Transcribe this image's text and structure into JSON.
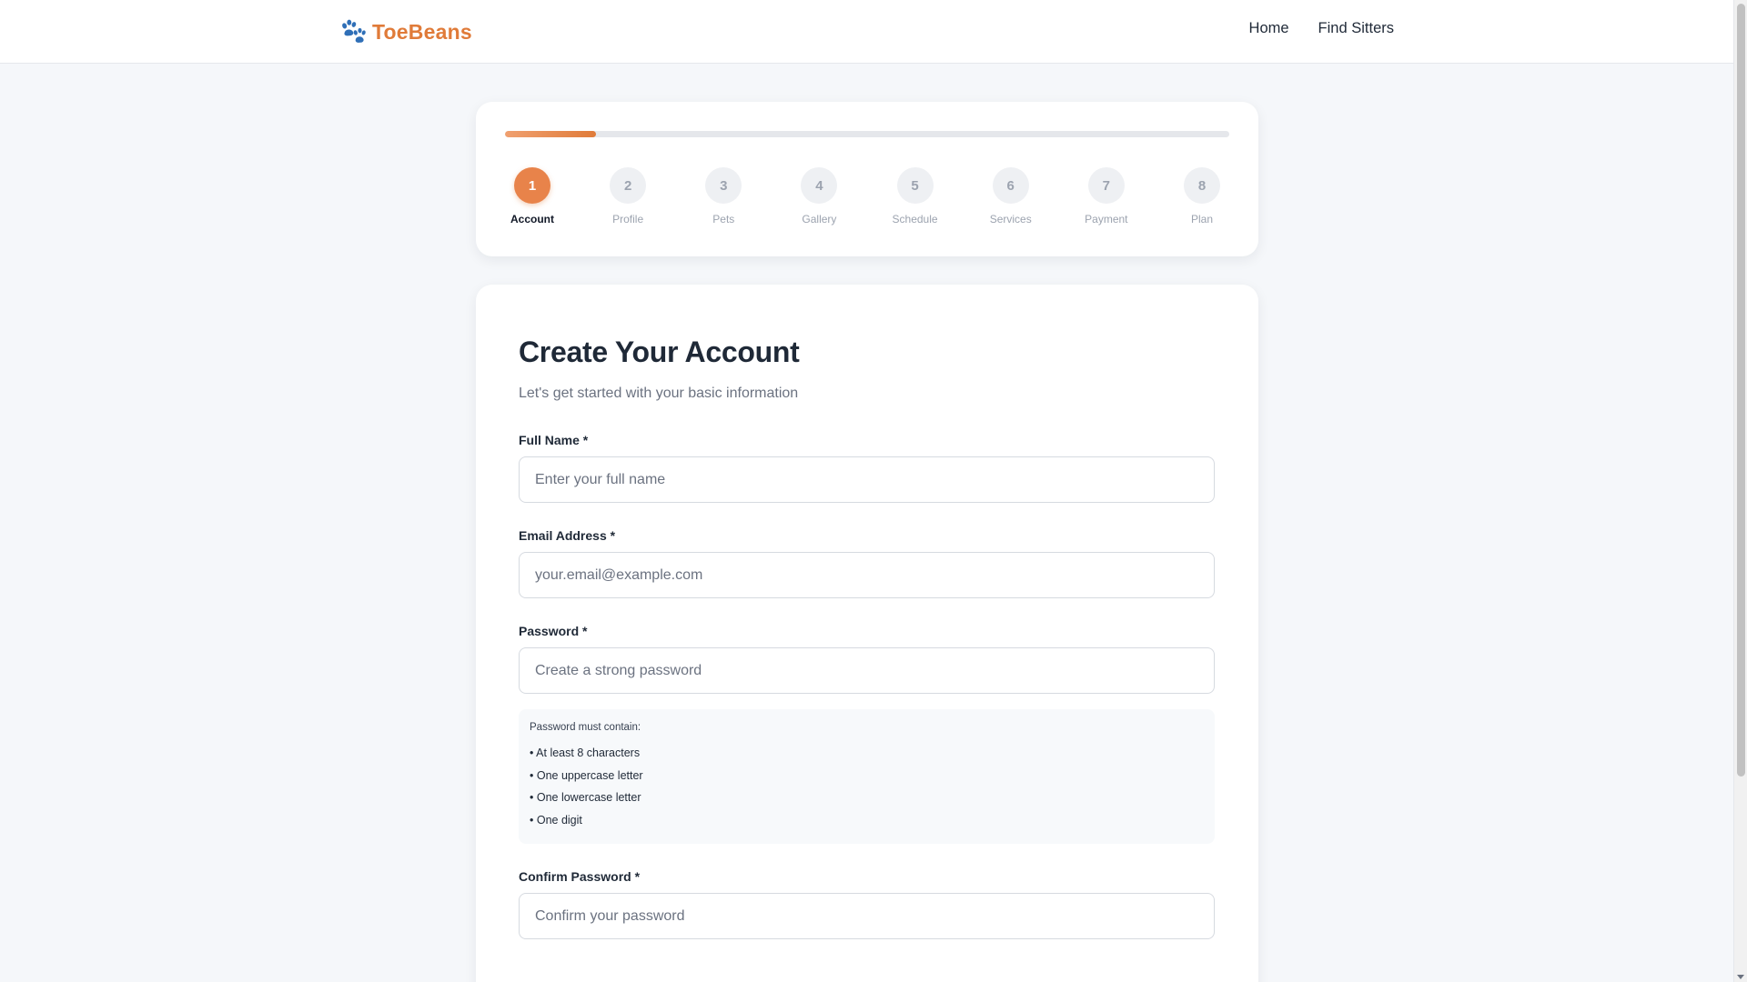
{
  "header": {
    "brand": "ToeBeans",
    "logo_icon": "paw-icon",
    "brand_color": "#e07b39",
    "nav": [
      {
        "label": "Home"
      },
      {
        "label": "Find Sitters"
      }
    ]
  },
  "progress": {
    "current_step": 1,
    "total_steps": 8,
    "fill_fraction": 0.125,
    "accent_color": "#e8834a",
    "steps": [
      {
        "number": "1",
        "label": "Account",
        "active": true
      },
      {
        "number": "2",
        "label": "Profile",
        "active": false
      },
      {
        "number": "3",
        "label": "Pets",
        "active": false
      },
      {
        "number": "4",
        "label": "Gallery",
        "active": false
      },
      {
        "number": "5",
        "label": "Schedule",
        "active": false
      },
      {
        "number": "6",
        "label": "Services",
        "active": false
      },
      {
        "number": "7",
        "label": "Payment",
        "active": false
      },
      {
        "number": "8",
        "label": "Plan",
        "active": false
      }
    ]
  },
  "form": {
    "title": "Create Your Account",
    "subtitle": "Let's get started with your basic information",
    "full_name": {
      "label": "Full Name *",
      "placeholder": "Enter your full name",
      "value": ""
    },
    "email": {
      "label": "Email Address *",
      "placeholder": "your.email@example.com",
      "value": ""
    },
    "password": {
      "label": "Password *",
      "placeholder": "Create a strong password",
      "value": ""
    },
    "password_hint": {
      "title": "Password must contain:",
      "items": [
        "• At least 8 characters",
        "• One uppercase letter",
        "• One lowercase letter",
        "• One digit"
      ]
    },
    "confirm_password": {
      "label": "Confirm Password *",
      "placeholder": "Confirm your password",
      "value": ""
    }
  }
}
